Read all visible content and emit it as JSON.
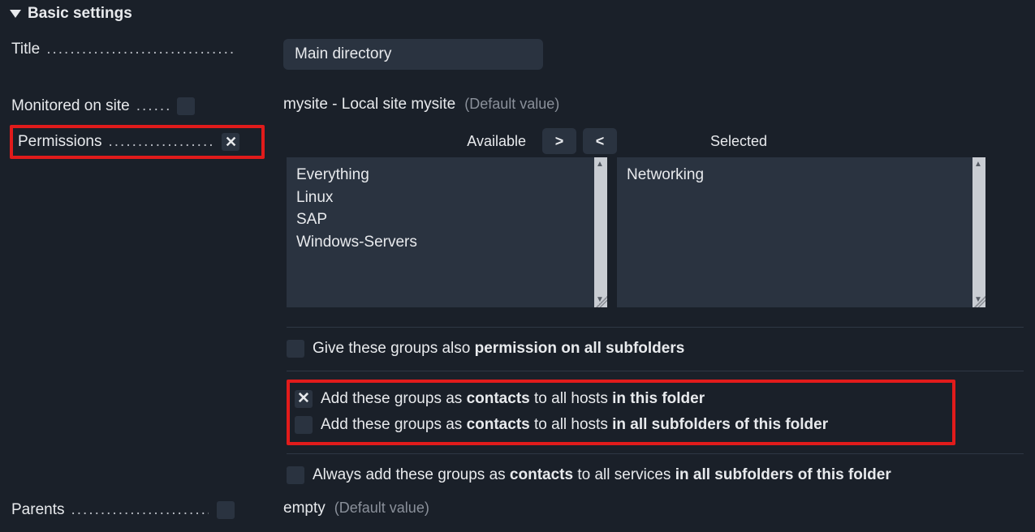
{
  "section_title": "Basic settings",
  "fields": {
    "title": {
      "label": "Title",
      "value": "Main directory"
    },
    "monitored": {
      "label": "Monitored on site",
      "value": "mysite - Local site mysite",
      "default_suffix": "(Default value)"
    },
    "permissions": {
      "label": "Permissions",
      "available_header": "Available",
      "selected_header": "Selected",
      "available_items": [
        "Everything",
        "Linux",
        "SAP",
        "Windows-Servers"
      ],
      "selected_items": [
        "Networking"
      ],
      "move_right_label": ">",
      "move_left_label": "<",
      "option_subfolders_prefix": "Give these groups also ",
      "option_subfolders_bold": "permission on all subfolders",
      "option_contacts_folder_prefix": "Add these groups as ",
      "option_contacts_word": "contacts",
      "option_contacts_folder_mid": " to all hosts ",
      "option_contacts_folder_bold": "in this folder",
      "option_contacts_subfolders_bold": "in all subfolders of this folder",
      "option_services_prefix": "Always add these groups as ",
      "option_services_mid": " to all services ",
      "option_services_bold": "in all subfolders of this folder"
    },
    "parents": {
      "label": "Parents",
      "value": "empty",
      "default_suffix": "(Default value)"
    }
  }
}
